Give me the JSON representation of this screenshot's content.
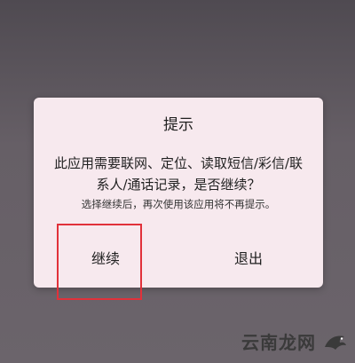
{
  "dialog": {
    "title": "提示",
    "message": "此应用需要联网、定位、读取短信/彩信/联系人/通话记录，是否继续？",
    "note": "选择继续后，再次使用该应用将不再提示。",
    "continue_label": "继续",
    "exit_label": "退出"
  },
  "watermark": {
    "text": "云南龙网"
  },
  "colors": {
    "dialog_background": "#f7e9ee",
    "highlight": "#e1313a",
    "screen_background": "#5f5960"
  }
}
